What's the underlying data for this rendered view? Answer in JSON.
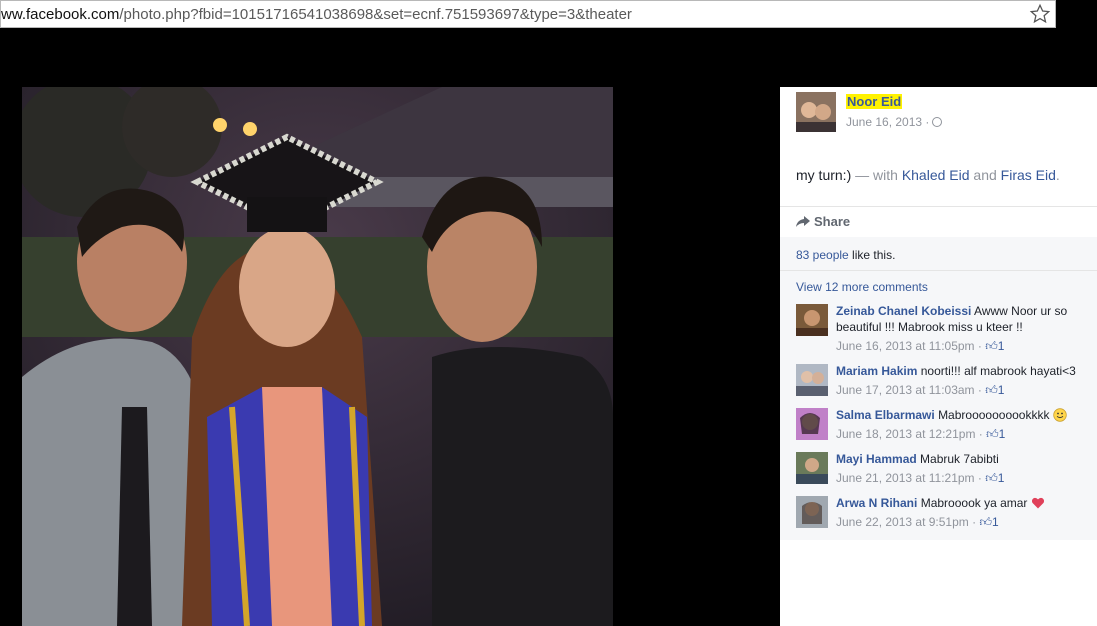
{
  "browser": {
    "url_domain": "ww.facebook.com",
    "url_rest": "/photo.php?fbid=10151716541038698&set=ecnf.751593697&type=3&theater"
  },
  "post": {
    "author": "Noor Eid",
    "date": "June 16, 2013",
    "date_sep": "·",
    "caption_text": "my turn:)",
    "caption_with": " — with ",
    "tag_1": "Khaled Eid",
    "tag_and": " and ",
    "tag_2": "Firas Eid",
    "tag_end": ".",
    "share_label": "Share",
    "likes_count": "83 people",
    "likes_suffix": " like this.",
    "view_more": "View 12 more comments"
  },
  "comments": [
    {
      "name": "Zeinab Chanel Kobeissi",
      "text": "Awww Noor ur so beautiful !!! Mabrook miss u kteer !!",
      "time": "June 16, 2013 at 11:05pm",
      "likes": "1"
    },
    {
      "name": "Mariam Hakim",
      "text": "noorti!!! alf mabrook hayati<3",
      "time": "June 17, 2013 at 11:03am",
      "likes": "1"
    },
    {
      "name": "Salma Elbarmawi",
      "text": "Mabroooooooookkkk",
      "time": "June 18, 2013 at 12:21pm",
      "likes": "1"
    },
    {
      "name": "Mayi Hammad",
      "text": "Mabruk 7abibti",
      "time": "June 21, 2013 at 11:21pm",
      "likes": "1"
    },
    {
      "name": "Arwa N Rihani",
      "text": "Mabrooook ya amar",
      "time": "June 22, 2013 at 9:51pm",
      "likes": "1"
    }
  ],
  "icons": {
    "star": "star-icon",
    "globe": "globe-icon",
    "share": "share-arrow-icon",
    "like": "thumbs-up-icon",
    "smile": "smile-emoji-icon",
    "heart": "heart-emoji-icon"
  },
  "colors": {
    "link": "#365899",
    "highlight": "#fff200",
    "muted": "#90949c"
  }
}
